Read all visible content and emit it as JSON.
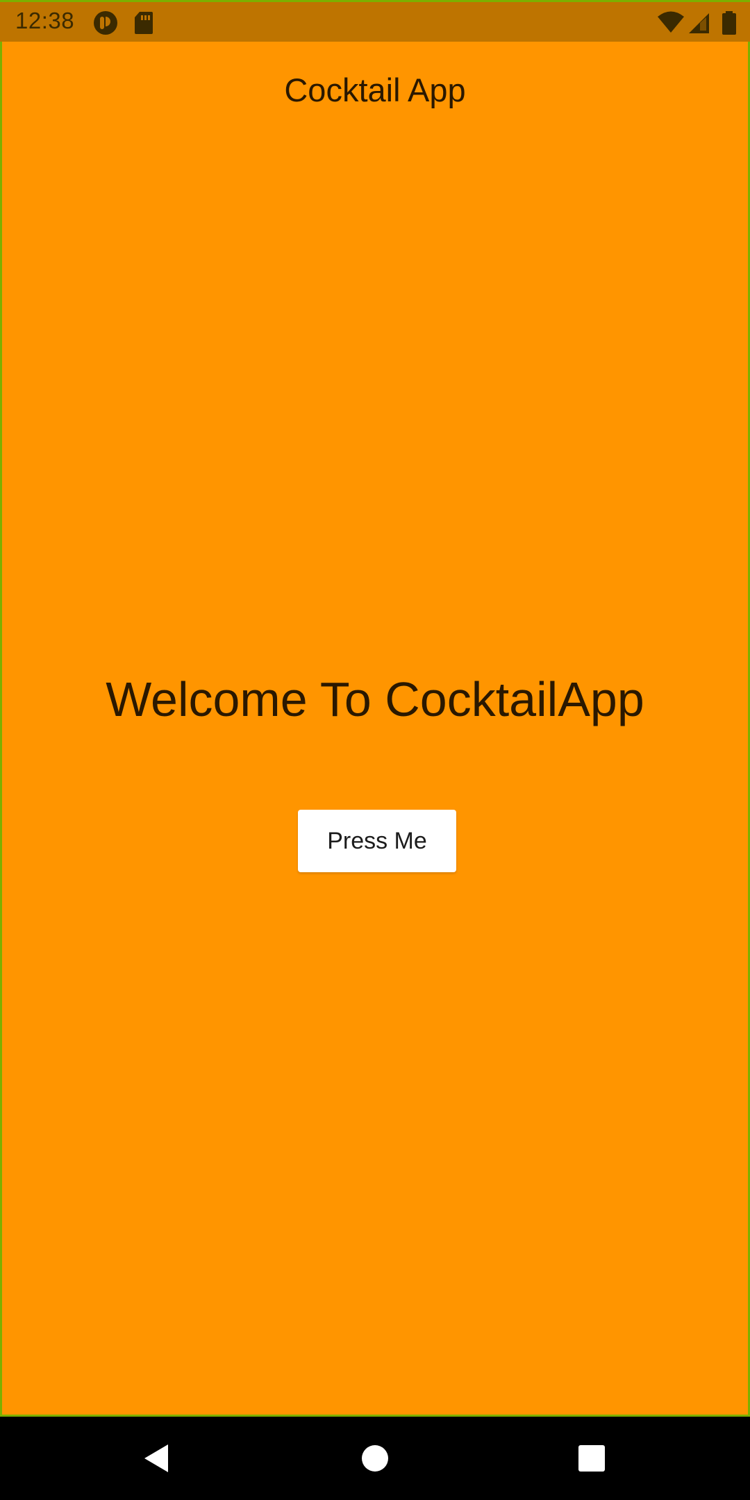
{
  "status_bar": {
    "time": "12:38",
    "left_icons": [
      "app-notification-icon",
      "sd-card-icon"
    ],
    "right_icons": [
      "wifi-icon",
      "cellular-signal-icon",
      "battery-icon"
    ],
    "background_color": "#BE7400"
  },
  "app_bar": {
    "title": "Cocktail App"
  },
  "main": {
    "welcome_text": "Welcome To CocktailApp",
    "button_label": "Press Me",
    "background_color": "#FF9500"
  },
  "nav_bar": {
    "buttons": [
      "back-icon",
      "home-icon",
      "recents-icon"
    ]
  }
}
